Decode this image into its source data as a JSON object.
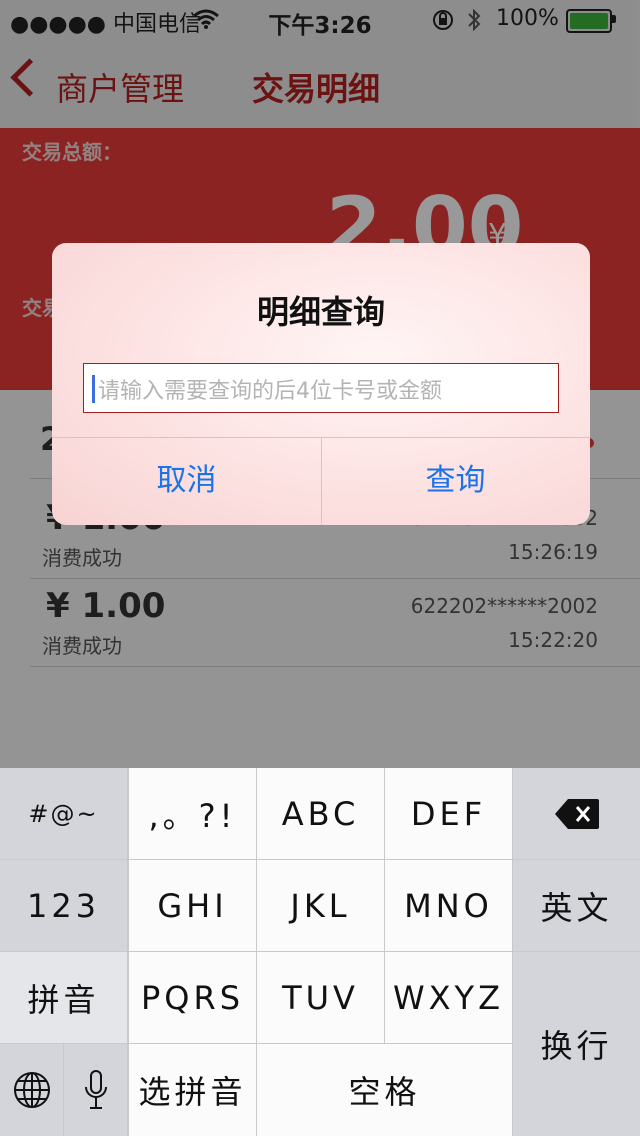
{
  "status_bar": {
    "carrier": "●●●●● 中国电信",
    "time": "下午3:26",
    "battery_pct": "100%"
  },
  "nav": {
    "back_label": "商户管理",
    "title": "交易明细"
  },
  "summary": {
    "label": "交易总额：",
    "amount": "2.00",
    "currency": "¥",
    "second_label": "交易"
  },
  "list": {
    "rows": [
      {
        "amount": "",
        "status": "",
        "card": "",
        "time": ""
      },
      {
        "amount": "¥ 1.00",
        "status": "消费成功",
        "card": "622202******2002",
        "time": "15:26:19"
      },
      {
        "amount": "¥ 1.00",
        "status": "消费成功",
        "card": "622202******2002",
        "time": "15:22:20"
      }
    ],
    "first_row_peek": "2"
  },
  "dialog": {
    "title": "明细查询",
    "input_placeholder": "请输入需要查询的后4位卡号或金额",
    "input_value": "",
    "cancel_label": "取消",
    "confirm_label": "查询"
  },
  "keyboard": {
    "symbols": "#@~",
    "punct": ",。?!",
    "abc": "ABC",
    "def": "DEF",
    "num": "123",
    "ghi": "GHI",
    "jkl": "JKL",
    "mno": "MNO",
    "english": "英文",
    "pinyin": "拼音",
    "pqrs": "PQRS",
    "tuv": "TUV",
    "wxyz": "WXYZ",
    "return": "换行",
    "select_pinyin": "选拼音",
    "space": "空格"
  },
  "colors": {
    "accent_red": "#e63b3a",
    "nav_red": "#b3211f",
    "link_blue": "#1a73e8"
  },
  "icons": [
    "wifi-icon",
    "rotation-lock-icon",
    "bluetooth-icon",
    "battery-icon",
    "back-chevron-icon",
    "backspace-icon",
    "globe-icon",
    "microphone-icon"
  ]
}
